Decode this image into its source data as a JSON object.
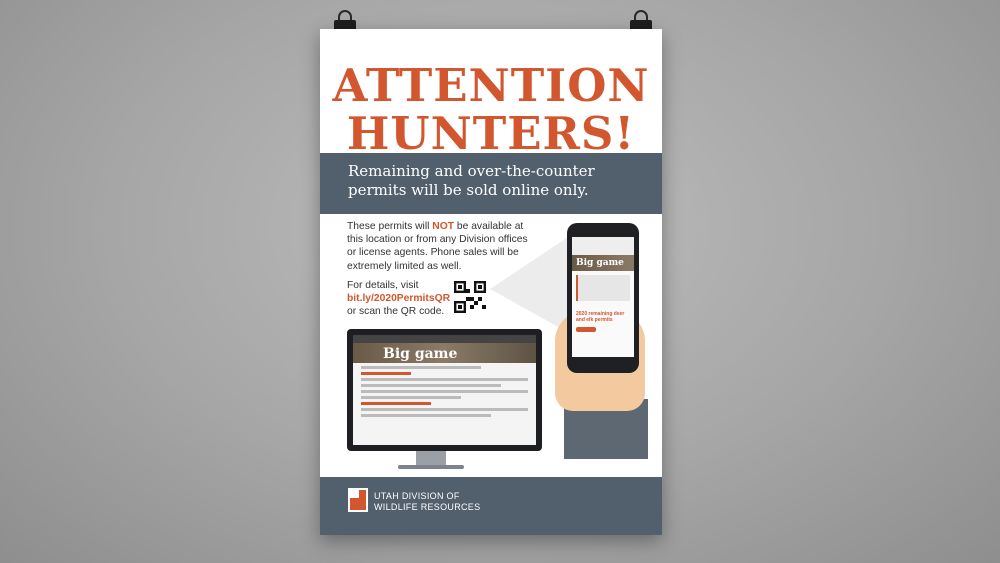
{
  "poster": {
    "headline": {
      "line1": "ATTENTION",
      "line2": "HUNTERS!"
    },
    "subhead": {
      "line1": "Remaining and over-the-counter",
      "line2": "permits will be sold online only."
    },
    "body": {
      "part1": "These permits will ",
      "highlight": "NOT",
      "part2": " be available at this location or from any Division offices or license agents. Phone sales will be extremely limited as well."
    },
    "details": {
      "line1": "For details, visit",
      "link": "bit.ly/2020PermitsQR",
      "line3": "or scan the QR code."
    },
    "monitor_screen": {
      "hero_title": "Big game"
    },
    "phone_screen": {
      "hero_title": "Big game",
      "heading": "2020 remaining deer and elk permits"
    },
    "footer": {
      "org_line1": "UTAH DIVISION OF",
      "org_line2": "WILDLIFE RESOURCES"
    }
  },
  "colors": {
    "accent": "#d2572f",
    "band": "#525f6c"
  }
}
